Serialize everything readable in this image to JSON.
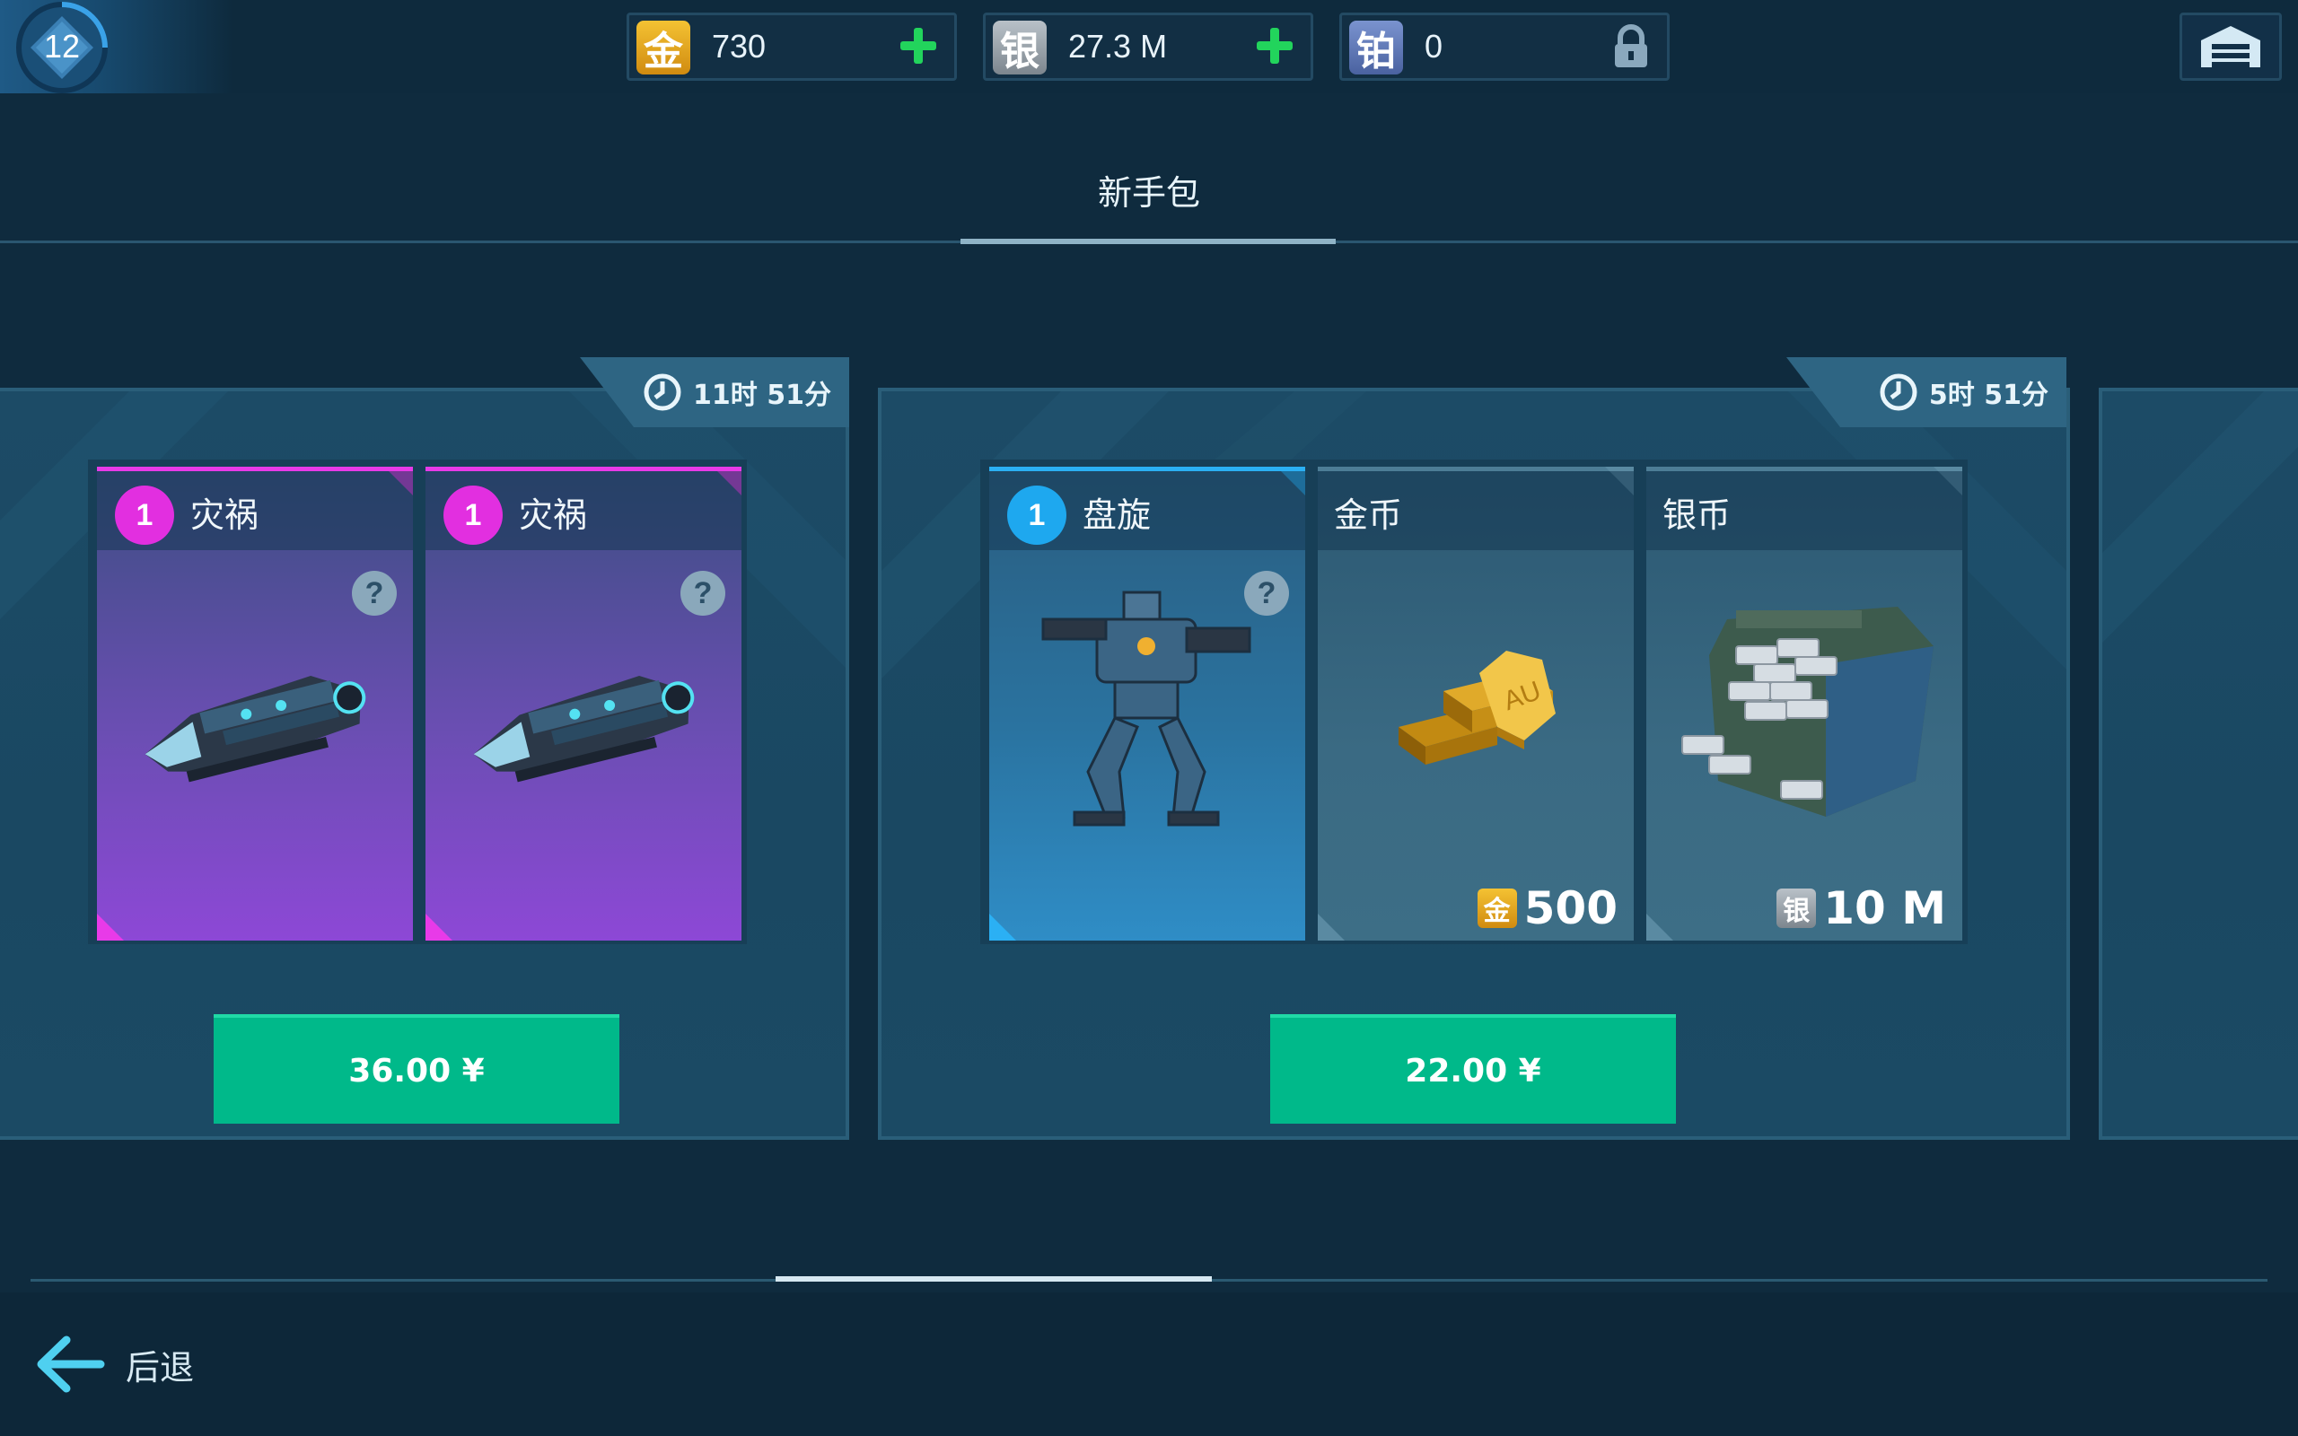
{
  "player": {
    "level": "12"
  },
  "currencies": [
    {
      "icon": "gold-currency-icon",
      "glyph": "金",
      "value": "730",
      "action": "add"
    },
    {
      "icon": "silver-currency-icon",
      "glyph": "银",
      "value": "27.3 M",
      "action": "add"
    },
    {
      "icon": "platinum-currency-icon",
      "glyph": "铂",
      "value": "0",
      "action": "locked"
    }
  ],
  "page": {
    "title": "新手包"
  },
  "bundles": [
    {
      "timer": "11时 51分",
      "price": "36.00 ¥",
      "items": [
        {
          "badge": "1",
          "name": "灾祸",
          "help": "?",
          "kind": "weapon"
        },
        {
          "badge": "1",
          "name": "灾祸",
          "help": "?",
          "kind": "weapon"
        }
      ]
    },
    {
      "timer": "5时 51分",
      "price": "22.00 ¥",
      "items": [
        {
          "badge": "1",
          "name": "盘旋",
          "help": "?",
          "kind": "robot"
        },
        {
          "name": "金币",
          "kind": "gold",
          "amount_glyph": "金",
          "amount": "500"
        },
        {
          "name": "银币",
          "kind": "silver",
          "amount_glyph": "银",
          "amount": "10 M"
        }
      ]
    }
  ],
  "footer": {
    "back_label": "后退"
  },
  "colors": {
    "accent_green": "#00b98a",
    "plus_green": "#22d45c",
    "rare_purple": "#e22fe0",
    "rare_blue": "#1ea8ef",
    "gold": "#e6a817",
    "silver": "#9aa3ab",
    "platinum": "#5d78b8"
  }
}
